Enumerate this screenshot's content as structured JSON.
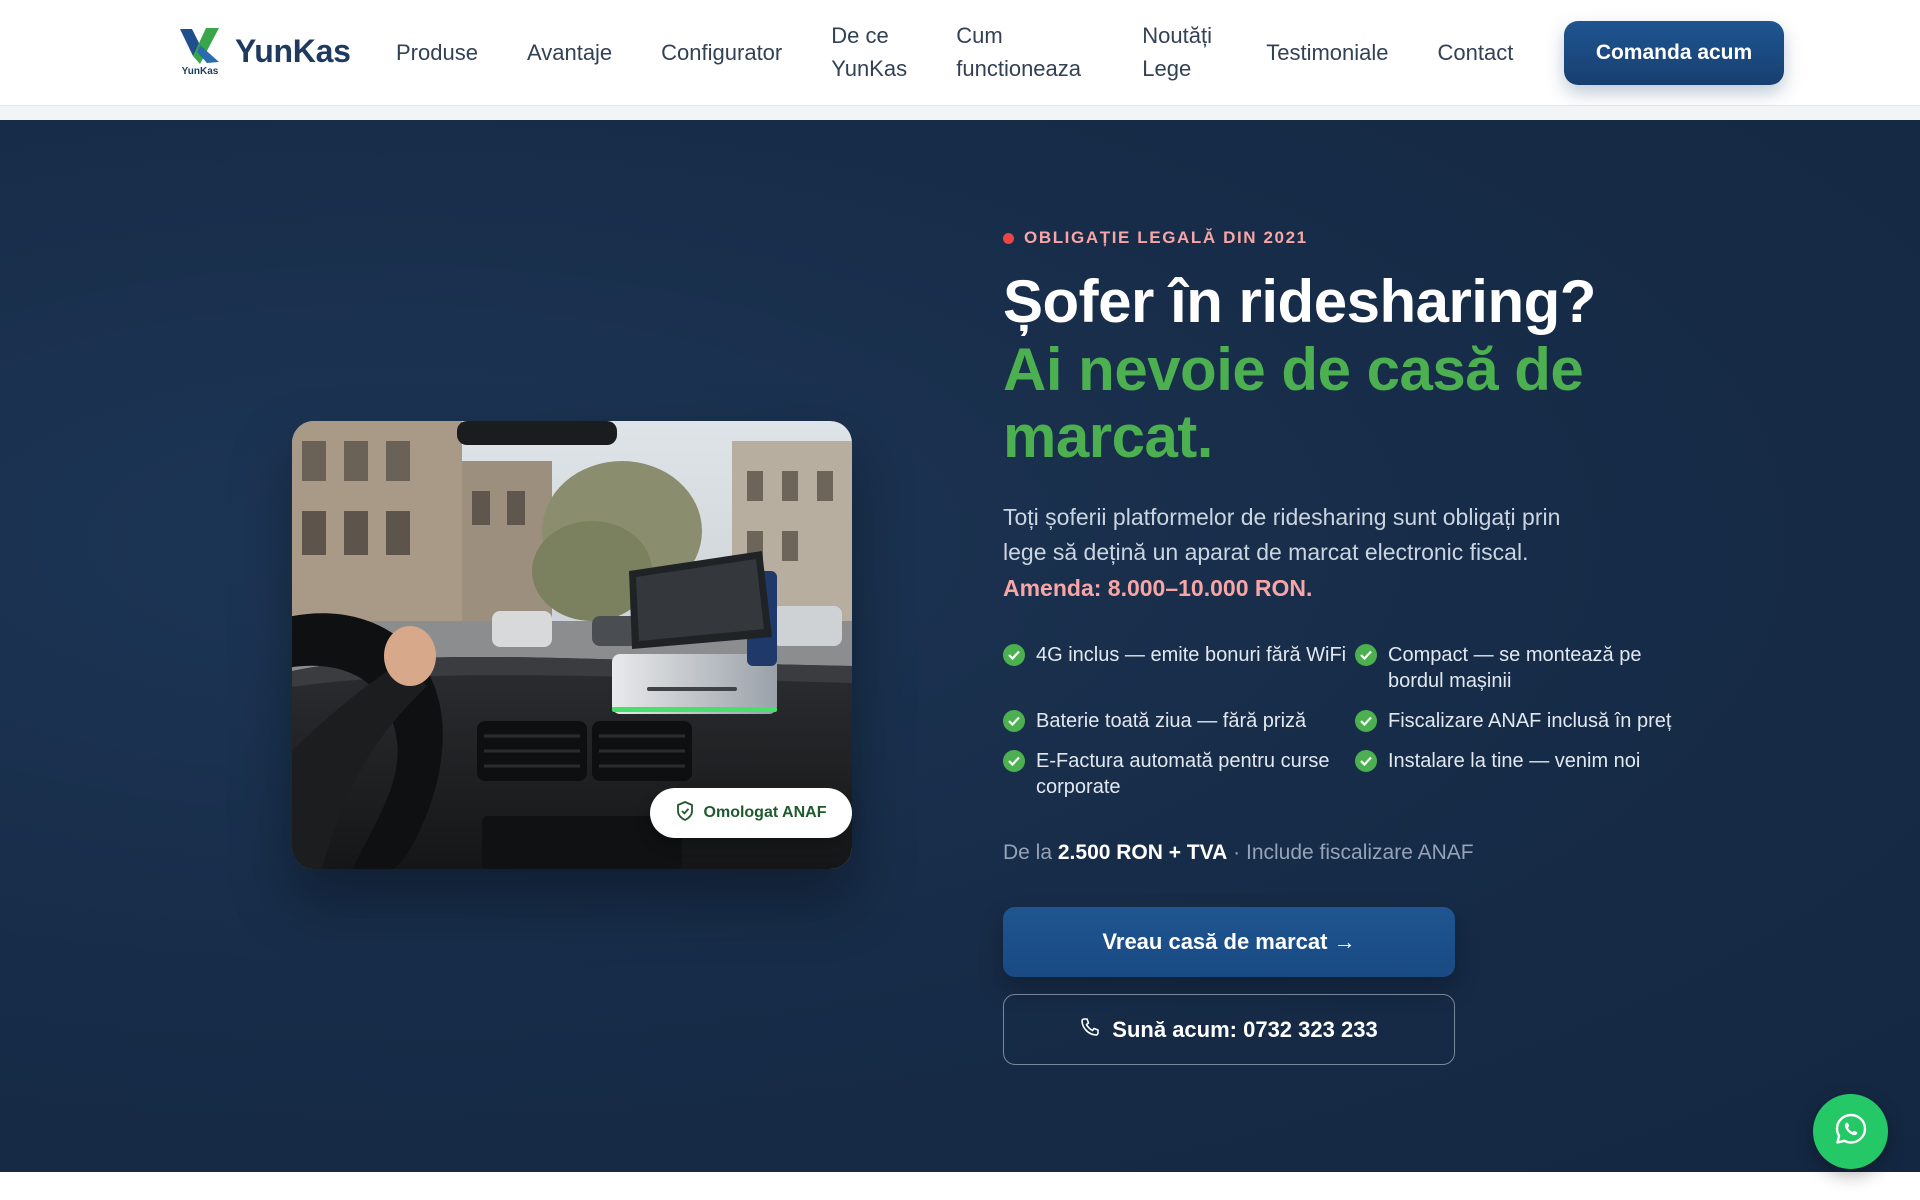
{
  "brand": {
    "name": "YunKas",
    "logo_caption": "YunKas",
    "icon": "yunkas-logo"
  },
  "nav": {
    "items": [
      {
        "label": "Produse"
      },
      {
        "label": "Avantaje"
      },
      {
        "label": "Configurator"
      },
      {
        "label": "De ce YunKas"
      },
      {
        "label": "Cum functioneaza"
      },
      {
        "label": "Noutăți Lege"
      },
      {
        "label": "Testimoniale"
      },
      {
        "label": "Contact"
      }
    ],
    "cta_label": "Comanda acum"
  },
  "hero": {
    "kicker": "OBLIGAȚIE LEGALĂ DIN 2021",
    "title_white": "Șofer în ridesharing?",
    "title_green": "Ai nevoie de casă de marcat.",
    "lead": "Toți șoferii platformelor de ridesharing sunt obligați prin lege să dețină un aparat de marcat electronic fiscal.",
    "fine": "Amenda: 8.000–10.000 RON.",
    "features": [
      {
        "text": "4G inclus — emite bonuri fără WiFi"
      },
      {
        "text": "Compact — se montează pe bordul mașinii"
      },
      {
        "text": "Baterie toată ziua — fără priză"
      },
      {
        "text": "Fiscalizare ANAF inclusă în preț"
      },
      {
        "text": "E-Factura automată pentru curse corporate"
      },
      {
        "text": "Instalare la tine — venim noi"
      }
    ],
    "price": {
      "prefix": "De la",
      "amount": "2.500 RON + TVA",
      "suffix": "· Include fiscalizare ANAF"
    },
    "primary_button": "Vreau casă de marcat →",
    "call_button": "Sună acum: 0732 323 233",
    "badge": "Omologat ANAF"
  },
  "colors": {
    "accent_green": "#4caf50",
    "brand_blue": "#1e4f8a",
    "hero_bg": "#172c48",
    "alert_red": "#ef4444",
    "whatsapp_green": "#25c866"
  },
  "icons": [
    "check-icon",
    "shield-icon",
    "phone-icon",
    "whatsapp-icon"
  ]
}
